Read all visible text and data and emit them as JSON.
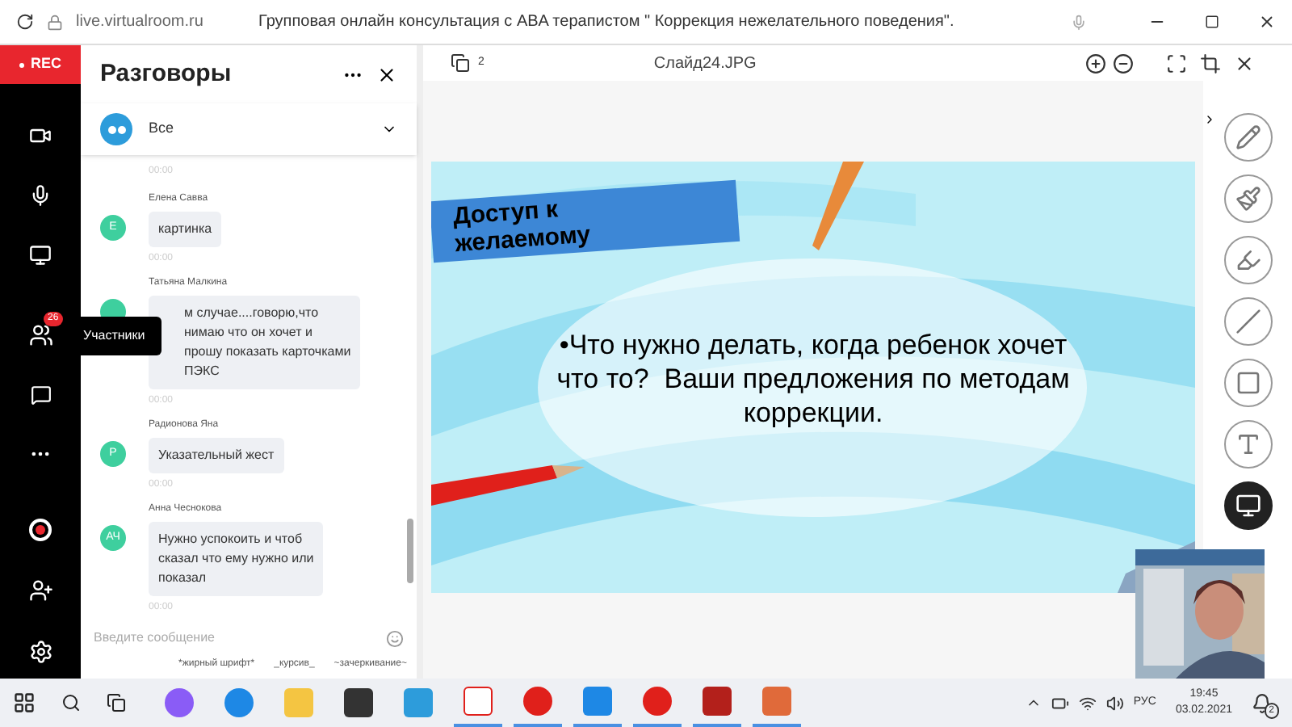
{
  "browser": {
    "url": "live.virtualroom.ru",
    "title": "Групповая онлайн консультация с ABA терапистом \" Коррекция нежелательного поведения\"."
  },
  "sidebar": {
    "rec_label": "REC",
    "participants_badge": "26",
    "tooltip": "Участники"
  },
  "chat": {
    "title": "Разговоры",
    "filter": "Все",
    "top_time": "00:00",
    "messages": [
      {
        "author": "Елена Савва",
        "initials": "Е",
        "lines": [
          "картинка"
        ],
        "time": "00:00",
        "covered": false
      },
      {
        "author": "Татьяна Малкина",
        "lines": [
          "м случае....говорю,что",
          "нимаю что он хочет и",
          "прошу показать карточками",
          "ПЭКС"
        ],
        "time": "00:00",
        "covered": true
      },
      {
        "author": "Радионова Яна",
        "initials": "Р",
        "lines": [
          "Указательный жест"
        ],
        "time": "00:00",
        "covered": false
      },
      {
        "author": "Анна Чеснокова",
        "initials": "АЧ",
        "lines": [
          "Нужно успокоить и чтоб",
          "сказал что ему нужно или",
          "показал"
        ],
        "time": "00:00",
        "covered": false
      }
    ],
    "placeholder": "Введите сообщение",
    "format_hints": [
      "*жирный шрифт*",
      "_курсив_",
      "~зачеркивание~"
    ]
  },
  "viewer": {
    "page_count": "2",
    "filename": "Слайд24.JPG",
    "slide": {
      "heading_lines": [
        "Доступ к",
        "желаемому"
      ],
      "bullet_lines": [
        "•Что нужно делать, когда ребенок хочет",
        "что то?  Ваши предложения по методам",
        "коррекции."
      ]
    }
  },
  "taskbar": {
    "time": "19:45",
    "date": "03.02.2021",
    "language": "РУС",
    "notifications": "2"
  }
}
